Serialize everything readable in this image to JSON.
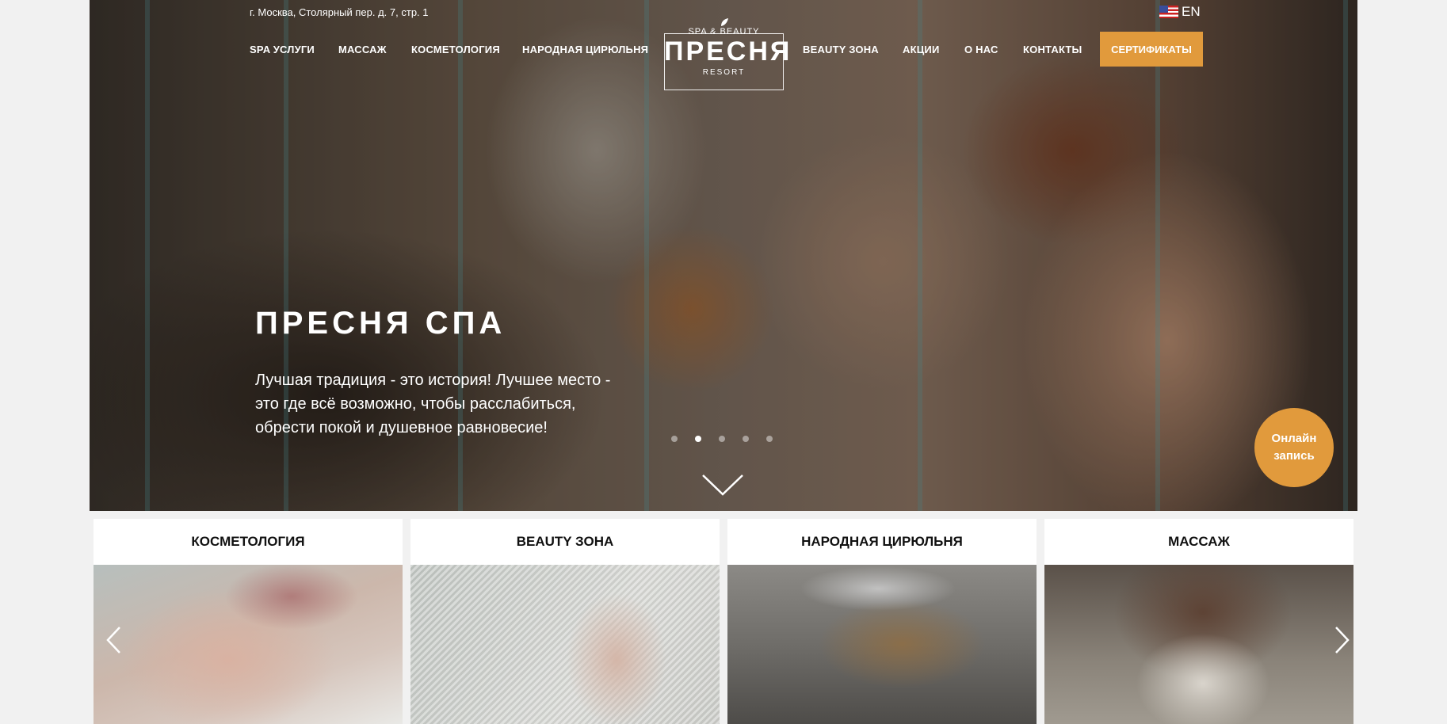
{
  "header": {
    "address": "г. Москва, Столярный пер. д. 7, стр. 1",
    "language": "EN"
  },
  "nav": {
    "left": [
      "SPA УСЛУГИ",
      "МАССАЖ",
      "КОСМЕТОЛОГИЯ",
      "НАРОДНАЯ ЦИРЮЛЬНЯ"
    ],
    "right": [
      "BEAUTY ЗОНА",
      "АКЦИИ",
      "О НАС",
      "КОНТАКТЫ"
    ],
    "certificates": "СЕРТИФИКАТЫ"
  },
  "logo": {
    "top": "SPA & BEAUTY",
    "name": "ПРЕСНЯ",
    "bottom": "RESORT"
  },
  "hero": {
    "title": "ПРЕСНЯ СПА",
    "text": "Лучшая традиция - это история! Лучшее место - это где всё возможно, чтобы расслабиться, обрести покой и душевное равновесие!",
    "slide_count": 5,
    "active_slide": 2
  },
  "online_booking": {
    "line1": "Онлайн",
    "line2": "запись"
  },
  "cards": [
    {
      "title": "КОСМЕТОЛОГИЯ"
    },
    {
      "title": "BEAUTY ЗОНА"
    },
    {
      "title": "НАРОДНАЯ ЦИРЮЛЬНЯ"
    },
    {
      "title": "МАССАЖ"
    }
  ],
  "icons": {
    "flag": "us-flag-icon",
    "scroll": "chevron-down-icon",
    "prev": "chevron-left-icon",
    "next": "chevron-right-icon"
  },
  "colors": {
    "accent": "#e19a3c",
    "page_bg": "#f1f1f1"
  }
}
